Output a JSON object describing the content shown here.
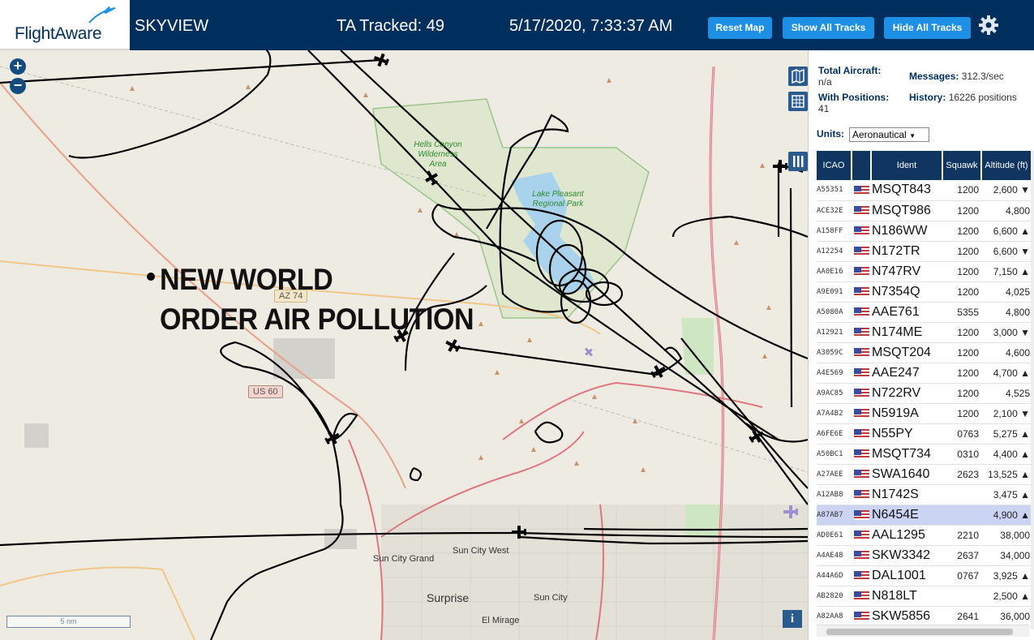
{
  "header": {
    "logo": "FlightAware",
    "app_name": "SKYVIEW",
    "ta_tracked": "TA Tracked: 49",
    "datetime": "5/17/2020, 7:33:37 AM",
    "buttons": {
      "reset": "Reset Map",
      "show_all": "Show All Tracks",
      "hide_all": "Hide All Tracks"
    }
  },
  "map": {
    "overlay_line1": "NEW WORLD",
    "overlay_line2": "ORDER AIR POLLUTION",
    "zoom_in": "+",
    "zoom_out": "−",
    "scale": "5 nm",
    "info": "i",
    "labels": {
      "hells_canyon": "Hells Canyon Wilderness Area",
      "lake_pleasant": "Lake Pleasant Regional Park",
      "az74": "AZ 74",
      "us60": "US 60",
      "sun_city_grand": "Sun City Grand",
      "sun_city_west": "Sun City West",
      "surprise": "Surprise",
      "sun_city": "Sun City",
      "el_mirage": "El Mirage"
    }
  },
  "panel": {
    "total_aircraft_label": "Total Aircraft:",
    "total_aircraft_value": "n/a",
    "with_positions_label": "With Positions:",
    "with_positions_value": "41",
    "messages_label": "Messages:",
    "messages_value": "312.3/sec",
    "history_label": "History:",
    "history_value": "16226 positions",
    "units_label": "Units:",
    "units_value": "Aeronautical",
    "columns": [
      "ICAO",
      "",
      "Ident",
      "Squawk",
      "Altitude (ft)"
    ],
    "rows": [
      {
        "icao": "A55351",
        "ident": "MSQT843",
        "squawk": "1200",
        "alt": "2,600 ▼"
      },
      {
        "icao": "ACE32E",
        "ident": "MSQT986",
        "squawk": "1200",
        "alt": "4,800"
      },
      {
        "icao": "A158FF",
        "ident": "N186WW",
        "squawk": "1200",
        "alt": "6,600 ▲"
      },
      {
        "icao": "A12254",
        "ident": "N172TR",
        "squawk": "1200",
        "alt": "6,600 ▼"
      },
      {
        "icao": "AA0E16",
        "ident": "N747RV",
        "squawk": "1200",
        "alt": "7,150 ▲"
      },
      {
        "icao": "A9E091",
        "ident": "N7354Q",
        "squawk": "1200",
        "alt": "4,025"
      },
      {
        "icao": "A5080A",
        "ident": "AAE761",
        "squawk": "5355",
        "alt": "4,800"
      },
      {
        "icao": "A12921",
        "ident": "N174ME",
        "squawk": "1200",
        "alt": "3,000 ▼"
      },
      {
        "icao": "A3059C",
        "ident": "MSQT204",
        "squawk": "1200",
        "alt": "4,600"
      },
      {
        "icao": "A4E569",
        "ident": "AAE247",
        "squawk": "1200",
        "alt": "4,700 ▲"
      },
      {
        "icao": "A9AC85",
        "ident": "N722RV",
        "squawk": "1200",
        "alt": "4,525"
      },
      {
        "icao": "A7A4B2",
        "ident": "N5919A",
        "squawk": "1200",
        "alt": "2,100 ▼"
      },
      {
        "icao": "A6FE6E",
        "ident": "N55PY",
        "squawk": "0763",
        "alt": "5,275 ▲"
      },
      {
        "icao": "A50BC1",
        "ident": "MSQT734",
        "squawk": "0310",
        "alt": "4,400 ▲"
      },
      {
        "icao": "A27AEE",
        "ident": "SWA1640",
        "squawk": "2623",
        "alt": "13,525 ▲"
      },
      {
        "icao": "A12AB8",
        "ident": "N1742S",
        "squawk": "",
        "alt": "3,475 ▲"
      },
      {
        "icao": "A87AB7",
        "ident": "N6454E",
        "squawk": "",
        "alt": "4,900 ▲",
        "selected": true
      },
      {
        "icao": "AD0E61",
        "ident": "AAL1295",
        "squawk": "2210",
        "alt": "38,000"
      },
      {
        "icao": "A4AE48",
        "ident": "SKW3342",
        "squawk": "2637",
        "alt": "34,000"
      },
      {
        "icao": "A44A6D",
        "ident": "DAL1001",
        "squawk": "0767",
        "alt": "3,925 ▲"
      },
      {
        "icao": "AB2820",
        "ident": "N818LT",
        "squawk": "",
        "alt": "2,500 ▲"
      },
      {
        "icao": "A82AA8",
        "ident": "SKW5856",
        "squawk": "2641",
        "alt": "36,000"
      }
    ]
  }
}
